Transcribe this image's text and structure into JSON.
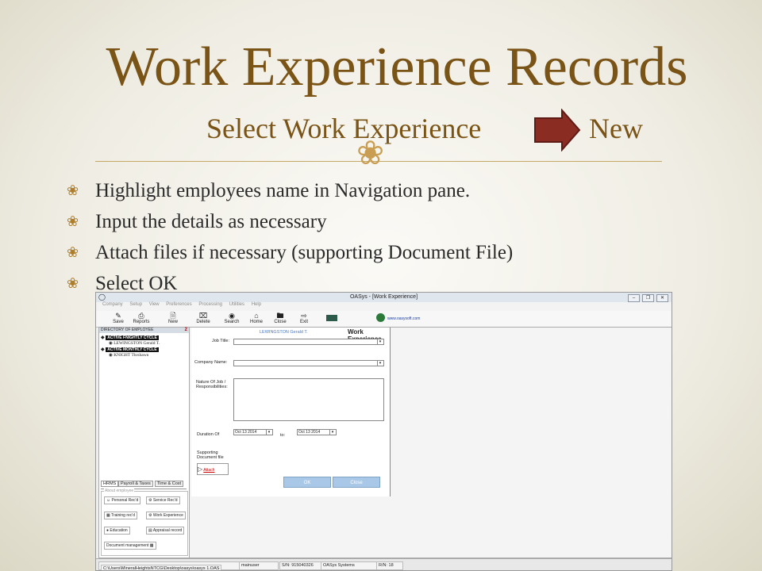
{
  "slide": {
    "title": "Work Experience Records",
    "subtitle_left": "Select Work Experience",
    "subtitle_right": "New",
    "bullets": [
      "Highlight employees name in Navigation pane.",
      "Input the details as necessary",
      "Attach files if necessary (supporting Document File)",
      "Select OK"
    ]
  },
  "app": {
    "window_title": "OASys - [Work Experience]",
    "menu": [
      "Company",
      "Setup",
      "View",
      "Preferences",
      "Processing",
      "Utilities",
      "Help"
    ],
    "toolbar": [
      "Save",
      "Reports",
      "New",
      "Delete",
      "Search",
      "Home",
      "Close",
      "Exit"
    ],
    "website": "www.oasysoft.com",
    "directory": {
      "header": "DIRECTORY OF EMPLOYEE",
      "badge": "2",
      "group1": "ACTIVE FNIGHTLY CYCLE",
      "emp1": "LEWINGSTON Gerald T.",
      "group2": "ACTIVE MONTHLY CYCLE",
      "emp2": "KNIGHT Thrshawn"
    },
    "tabs": [
      "HRMS",
      "Payroll & Taxes",
      "Time & Cost"
    ],
    "about_label": "About employee",
    "shortcuts": [
      "Personal Rec'd",
      "Service Rec'd",
      "Training rec'd",
      "Work Experience",
      "Education",
      "Appraisal record",
      "Document management"
    ],
    "form": {
      "employee": "LEWINGSTON Gerald T.",
      "heading": "Work Experience",
      "job_title_label": "Job Title:",
      "company_label": "Company Name:",
      "nature_label": "Nature Of Job / Responsibilities:",
      "duration_label": "Duration Of",
      "from_date": "Oct 13 2014",
      "to_label": "to:",
      "to_date": "Oct 13 2014",
      "supporting_label": "Supporting Document file",
      "attach_label": "Attach",
      "ok_label": "OK",
      "close_label": "Close"
    },
    "status": {
      "path": "C:\\Users\\MineralHeightsNTCG\\Desktop\\oasys\\oasys 1.OAS",
      "user": "mainuser",
      "serial": "S/N: 915040326",
      "company": "OASys Systems",
      "rn": "R/N: 18"
    }
  },
  "colors": {
    "title": "#7a5416",
    "arrow": "#8b2c22",
    "ornament": "#c99e52"
  }
}
